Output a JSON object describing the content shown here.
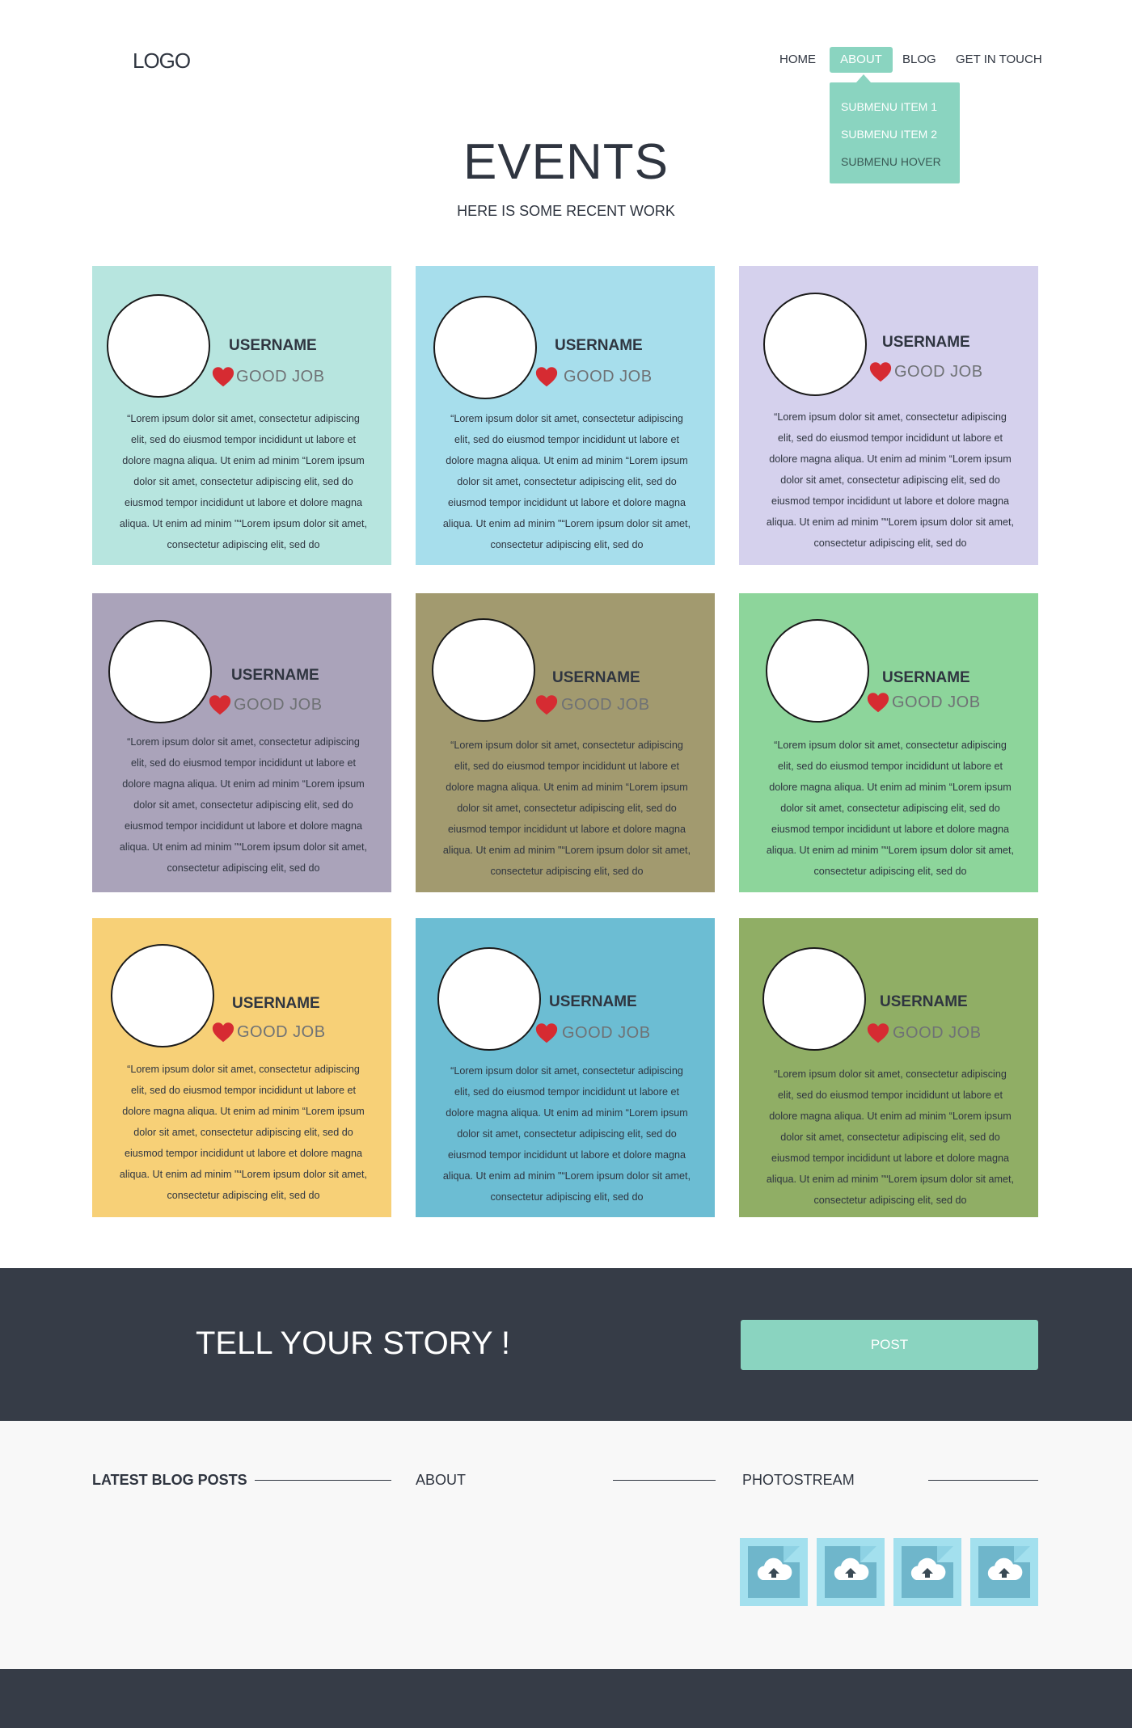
{
  "header": {
    "logo": "LOGO",
    "nav": [
      "HOME",
      "ABOUT",
      "BLOG",
      "GET IN TOUCH"
    ],
    "active_nav": "ABOUT",
    "submenu": [
      "SUBMENU ITEM 1",
      "SUBMENU ITEM 2",
      "SUBMENU HOVER"
    ]
  },
  "events": {
    "title": "EVENTS",
    "subtitle": "HERE IS SOME RECENT WORK"
  },
  "cards": [
    {
      "username": "USERNAME",
      "status": "GOOD JOB",
      "color": "#b7e5df",
      "text": "“Lorem ipsum dolor sit amet, consectetur adipiscing elit, sed do eiusmod tempor incididunt ut labore et dolore magna aliqua. Ut enim ad minim “Lorem ipsum dolor sit amet, consectetur adipiscing elit, sed do eiusmod tempor incididunt ut labore et dolore magna aliqua. Ut enim ad minim \"“Lorem ipsum dolor sit amet, consectetur adipiscing elit, sed do"
    },
    {
      "username": "USERNAME",
      "status": "GOOD JOB",
      "color": "#a7deec",
      "text": "“Lorem ipsum dolor sit amet, consectetur adipiscing elit, sed do eiusmod tempor incididunt ut labore et dolore magna aliqua. Ut enim ad minim “Lorem ipsum dolor sit amet, consectetur adipiscing elit, sed do eiusmod tempor incididunt ut labore et dolore magna aliqua. Ut enim ad minim \"“Lorem ipsum dolor sit amet, consectetur adipiscing elit, sed do"
    },
    {
      "username": "USERNAME",
      "status": "GOOD JOB",
      "color": "#d5d1ed",
      "text": "“Lorem ipsum dolor sit amet, consectetur adipiscing elit, sed do eiusmod tempor incididunt ut labore et dolore magna aliqua. Ut enim ad minim “Lorem ipsum dolor sit amet, consectetur adipiscing elit, sed do eiusmod tempor incididunt ut labore et dolore magna aliqua. Ut enim ad minim \"“Lorem ipsum dolor sit amet, consectetur adipiscing elit, sed do"
    },
    {
      "username": "USERNAME",
      "status": "GOOD JOB",
      "color": "#aaa3ba",
      "text": "“Lorem ipsum dolor sit amet, consectetur adipiscing elit, sed do eiusmod tempor incididunt ut labore et dolore magna aliqua. Ut enim ad minim “Lorem ipsum dolor sit amet, consectetur adipiscing elit, sed do eiusmod tempor incididunt ut labore et dolore magna aliqua. Ut enim ad minim \"“Lorem ipsum dolor sit amet, consectetur adipiscing elit, sed do"
    },
    {
      "username": "USERNAME",
      "status": "GOOD JOB",
      "color": "#a29a6f",
      "text": "“Lorem ipsum dolor sit amet, consectetur adipiscing elit, sed do eiusmod tempor incididunt ut labore et dolore magna aliqua. Ut enim ad minim “Lorem ipsum dolor sit amet, consectetur adipiscing elit, sed do eiusmod tempor incididunt ut labore et dolore magna aliqua. Ut enim ad minim \"“Lorem ipsum dolor sit amet, consectetur adipiscing elit, sed do"
    },
    {
      "username": "USERNAME",
      "status": "GOOD JOB",
      "color": "#8dd59b",
      "text": "“Lorem ipsum dolor sit amet, consectetur adipiscing elit, sed do eiusmod tempor incididunt ut labore et dolore magna aliqua. Ut enim ad minim “Lorem ipsum dolor sit amet, consectetur adipiscing elit, sed do eiusmod tempor incididunt ut labore et dolore magna aliqua. Ut enim ad minim \"“Lorem ipsum dolor sit amet, consectetur adipiscing elit, sed do"
    },
    {
      "username": "USERNAME",
      "status": "GOOD JOB",
      "color": "#f7d077",
      "text": "“Lorem ipsum dolor sit amet, consectetur adipiscing elit, sed do eiusmod tempor incididunt ut labore et dolore magna aliqua. Ut enim ad minim “Lorem ipsum dolor sit amet, consectetur adipiscing elit, sed do eiusmod tempor incididunt ut labore et dolore magna aliqua. Ut enim ad minim \"“Lorem ipsum dolor sit amet, consectetur adipiscing elit, sed do"
    },
    {
      "username": "USERNAME",
      "status": "GOOD JOB",
      "color": "#6cbdd3",
      "text": "“Lorem ipsum dolor sit amet, consectetur adipiscing elit, sed do eiusmod tempor incididunt ut labore et dolore magna aliqua. Ut enim ad minim “Lorem ipsum dolor sit amet, consectetur adipiscing elit, sed do eiusmod tempor incididunt ut labore et dolore magna aliqua. Ut enim ad minim \"“Lorem ipsum dolor sit amet, consectetur adipiscing elit, sed do"
    },
    {
      "username": "USERNAME",
      "status": "GOOD JOB",
      "color": "#90ae65",
      "text": "“Lorem ipsum dolor sit amet, consectetur adipiscing elit, sed do eiusmod tempor incididunt ut labore et dolore magna aliqua. Ut enim ad minim “Lorem ipsum dolor sit amet, consectetur adipiscing elit, sed do eiusmod tempor incididunt ut labore et dolore magna aliqua. Ut enim ad minim \"“Lorem ipsum dolor sit amet, consectetur adipiscing elit, sed do"
    }
  ],
  "story": {
    "title": "TELL YOUR STORY !",
    "button": "POST"
  },
  "footer": {
    "latest": "LATEST BLOG POSTS",
    "about": "ABOUT",
    "photostream": "PHOTOSTREAM",
    "photo_icon": "cloud-upload-icon"
  },
  "colors": {
    "accent": "#8ad4c0",
    "dark": "#363c47",
    "heart": "#d62b32"
  }
}
